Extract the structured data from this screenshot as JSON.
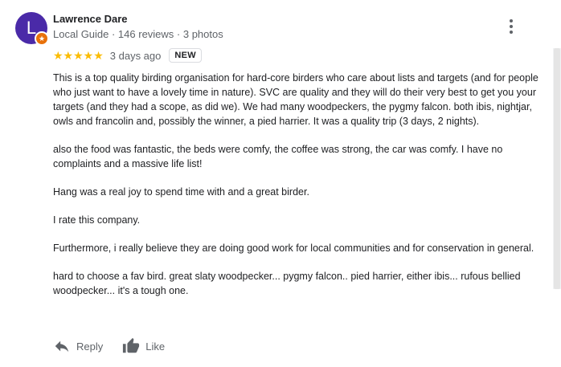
{
  "reviewer": {
    "avatar_letter": "L",
    "name": "Lawrence Dare",
    "meta": "Local Guide · 146 reviews · 3 photos"
  },
  "rating": {
    "stars": 5,
    "stars_text": "★★★★★",
    "date": "3 days ago",
    "badge": "NEW"
  },
  "review": {
    "paragraphs": [
      "This is a top quality birding organisation for hard-core birders who care about lists and targets (and for people who just want to have a lovely time in nature). SVC are quality and they will do their very best to get you your targets (and they had a scope, as did we). We had many woodpeckers, the pygmy falcon. both ibis, nightjar, owls and francolin and, possibly the winner, a pied harrier. It was a quality trip (3 days, 2 nights).",
      "also the food was fantastic, the beds were comfy, the coffee was strong, the car was comfy. I have no complaints and a massive life list!",
      "Hang was a real joy to spend time with and a great birder.",
      "I rate this company.",
      "Furthermore, i really believe they are doing good work for local communities and for conservation in general.",
      "hard to choose a fav bird. great slaty woodpecker... pygmy falcon.. pied harrier, either ibis... rufous bellied woodpecker... it's a tough one."
    ]
  },
  "actions": {
    "reply_label": "Reply",
    "like_label": "Like"
  },
  "colors": {
    "avatar": "#4a2aa8",
    "star": "#fbbc04",
    "local_guide_badge": "#e8710a"
  }
}
